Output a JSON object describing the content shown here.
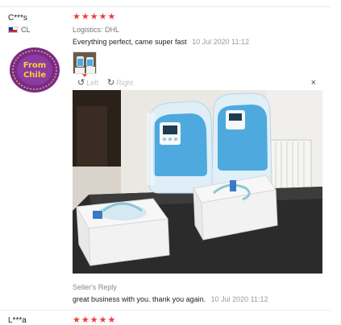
{
  "review": {
    "username": "C***s",
    "country": "CL",
    "sticker_text": "From Chile",
    "rating": 5,
    "logistics": "Logistics: DHL",
    "comment": "Everything perfect, came super fast",
    "date": "10 Jul 2020 11:12",
    "image_viewer": {
      "left_label": "Left",
      "right_label": "Right",
      "close_label": "×",
      "rotate_left_icon": "rotate-left-icon",
      "rotate_right_icon": "rotate-right-icon"
    },
    "seller_reply": {
      "label": "Seller's Reply",
      "text": "great business with you. thank you again.",
      "date": "10 Jul 2020 11:12"
    }
  },
  "next_review": {
    "username": "L***a",
    "rating": 5
  },
  "colors": {
    "star": "#ef3b3b",
    "sticker_purple": "#7a2b8a",
    "sticker_yellow": "#f4d13a",
    "device_blue": "#4ea9de"
  }
}
